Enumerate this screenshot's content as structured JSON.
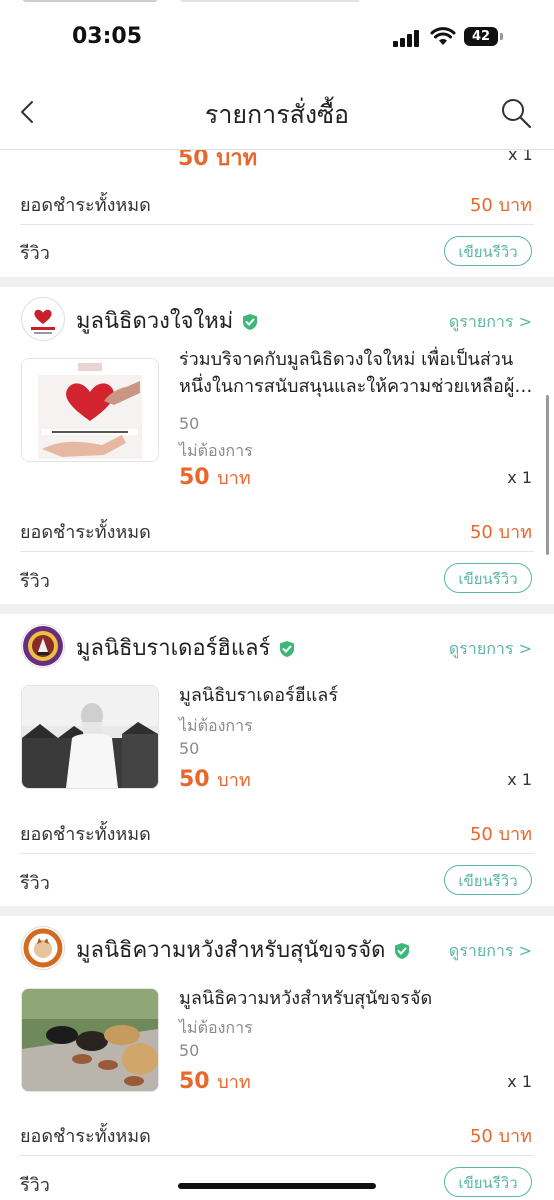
{
  "status": {
    "time": "03:05",
    "battery": "42"
  },
  "header": {
    "title": "รายการสั่งซื้อ"
  },
  "labels": {
    "total": "ยอดชำระทั้งหมด",
    "review": "รีวิว",
    "write_review": "เขียนรีวิว",
    "view_items": "ดูรายการ >"
  },
  "partial": {
    "price": "50 บาท",
    "qty": "x 1",
    "total": "50 บาท"
  },
  "orders": [
    {
      "shop": "มูลนิธิดวงใจใหม่",
      "product": "ร่วมบริจาคกับมูลนิธิดวงใจใหม่ เพื่อเป็นส่วนหนึ่งในการสนับสนุนและให้ความช่วยเหลือผู้ประสบภัย",
      "attr1": "50",
      "attr2": "ไม่ต้องการ",
      "price_num": "50",
      "price_unit": "บาท",
      "qty": "x 1",
      "total": "50 บาท"
    },
    {
      "shop": "มูลนิธิบราเดอร์ฮิแลร์",
      "product": "มูลนิธิบราเดอร์ฮีแลร์",
      "attr1": "ไม่ต้องการ",
      "attr2": "50",
      "price_num": "50",
      "price_unit": "บาท",
      "qty": "x 1",
      "total": "50 บาท"
    },
    {
      "shop": "มูลนิธิความหวังสำหรับสุนัขจรจัด",
      "product": "มูลนิธิความหวังสำหรับสุนัขจรจัด",
      "attr1": "ไม่ต้องการ",
      "attr2": "50",
      "price_num": "50",
      "price_unit": "บาท",
      "qty": "x 1",
      "total": "50 บาท"
    }
  ],
  "icons": [
    "back-icon",
    "search-icon",
    "verified-icon",
    "signal-icon",
    "wifi-icon",
    "battery-icon"
  ],
  "colors": {
    "accent": "#5bb7a3",
    "price": "#e9672b"
  }
}
